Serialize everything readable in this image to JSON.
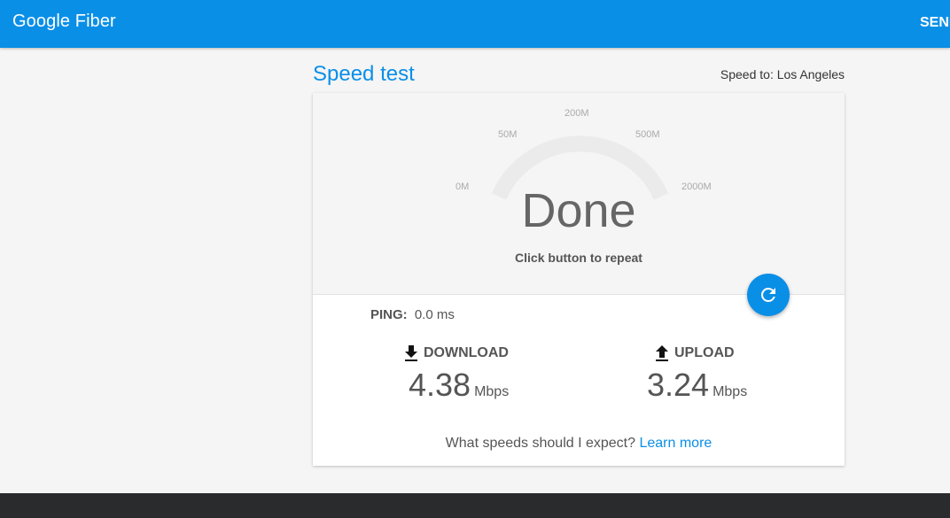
{
  "header": {
    "brand": "Google Fiber",
    "send_label": "SEND"
  },
  "page": {
    "title": "Speed test",
    "speed_to": "Speed to: Los Angeles"
  },
  "gauge": {
    "ticks": [
      "0M",
      "50M",
      "200M",
      "500M",
      "2000M"
    ],
    "status": "Done",
    "hint": "Click button to repeat"
  },
  "results": {
    "ping_label": "PING:",
    "ping_value": "0.0 ms",
    "download": {
      "label": "DOWNLOAD",
      "value": "4.38",
      "unit": "Mbps"
    },
    "upload": {
      "label": "UPLOAD",
      "value": "3.24",
      "unit": "Mbps"
    }
  },
  "expect": {
    "question": "What speeds should I expect?",
    "link": "Learn more"
  },
  "icons": {
    "repeat": "refresh-icon",
    "download": "download-arrow-icon",
    "upload": "upload-arrow-icon"
  },
  "colors": {
    "accent": "#0a8fe7",
    "footer": "#2a2b2d"
  }
}
